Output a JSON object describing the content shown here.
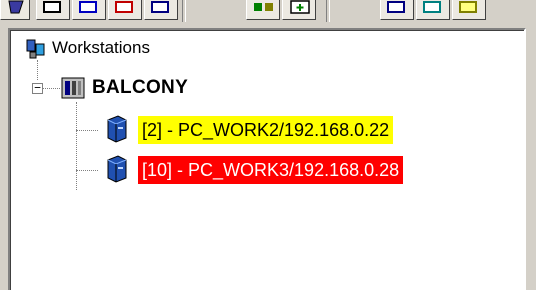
{
  "tree": {
    "root": {
      "label": "Workstations",
      "icon": "workstations-icon"
    },
    "group": {
      "label": "BALCONY",
      "icon": "server-icon",
      "expanded": true
    },
    "children": [
      {
        "label": "[2] - PC_WORK2/192.168.0.22",
        "icon": "computer-icon",
        "highlight": "#ffff00"
      },
      {
        "label": "[10] - PC_WORK3/192.168.0.28",
        "icon": "computer-icon",
        "highlight": "#ff0000",
        "text_color": "#ffffff"
      }
    ]
  },
  "colors": {
    "window_bg": "#d4d0c8",
    "tree_bg": "#ffffff"
  }
}
